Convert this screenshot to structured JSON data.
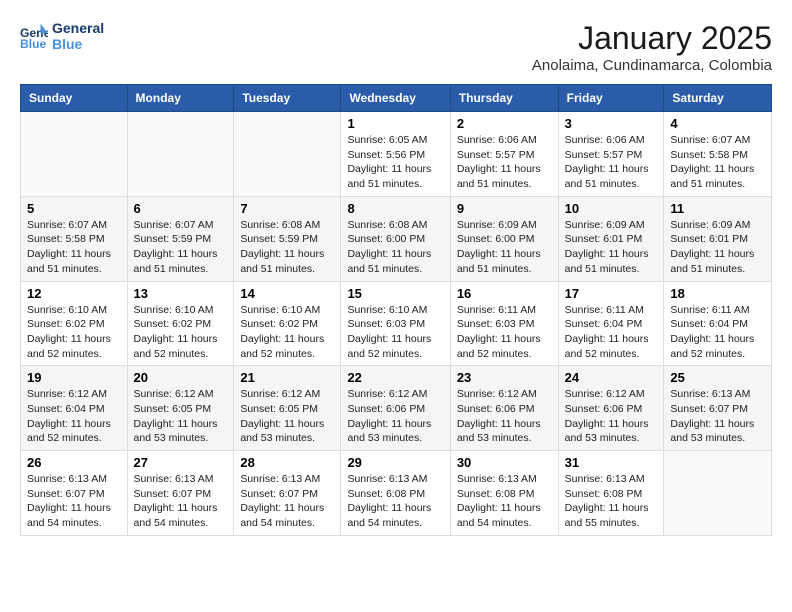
{
  "header": {
    "logo_line1": "General",
    "logo_line2": "Blue",
    "month_title": "January 2025",
    "location": "Anolaima, Cundinamarca, Colombia"
  },
  "weekdays": [
    "Sunday",
    "Monday",
    "Tuesday",
    "Wednesday",
    "Thursday",
    "Friday",
    "Saturday"
  ],
  "weeks": [
    [
      {
        "day": "",
        "sunrise": "",
        "sunset": "",
        "daylight": ""
      },
      {
        "day": "",
        "sunrise": "",
        "sunset": "",
        "daylight": ""
      },
      {
        "day": "",
        "sunrise": "",
        "sunset": "",
        "daylight": ""
      },
      {
        "day": "1",
        "sunrise": "Sunrise: 6:05 AM",
        "sunset": "Sunset: 5:56 PM",
        "daylight": "Daylight: 11 hours and 51 minutes."
      },
      {
        "day": "2",
        "sunrise": "Sunrise: 6:06 AM",
        "sunset": "Sunset: 5:57 PM",
        "daylight": "Daylight: 11 hours and 51 minutes."
      },
      {
        "day": "3",
        "sunrise": "Sunrise: 6:06 AM",
        "sunset": "Sunset: 5:57 PM",
        "daylight": "Daylight: 11 hours and 51 minutes."
      },
      {
        "day": "4",
        "sunrise": "Sunrise: 6:07 AM",
        "sunset": "Sunset: 5:58 PM",
        "daylight": "Daylight: 11 hours and 51 minutes."
      }
    ],
    [
      {
        "day": "5",
        "sunrise": "Sunrise: 6:07 AM",
        "sunset": "Sunset: 5:58 PM",
        "daylight": "Daylight: 11 hours and 51 minutes."
      },
      {
        "day": "6",
        "sunrise": "Sunrise: 6:07 AM",
        "sunset": "Sunset: 5:59 PM",
        "daylight": "Daylight: 11 hours and 51 minutes."
      },
      {
        "day": "7",
        "sunrise": "Sunrise: 6:08 AM",
        "sunset": "Sunset: 5:59 PM",
        "daylight": "Daylight: 11 hours and 51 minutes."
      },
      {
        "day": "8",
        "sunrise": "Sunrise: 6:08 AM",
        "sunset": "Sunset: 6:00 PM",
        "daylight": "Daylight: 11 hours and 51 minutes."
      },
      {
        "day": "9",
        "sunrise": "Sunrise: 6:09 AM",
        "sunset": "Sunset: 6:00 PM",
        "daylight": "Daylight: 11 hours and 51 minutes."
      },
      {
        "day": "10",
        "sunrise": "Sunrise: 6:09 AM",
        "sunset": "Sunset: 6:01 PM",
        "daylight": "Daylight: 11 hours and 51 minutes."
      },
      {
        "day": "11",
        "sunrise": "Sunrise: 6:09 AM",
        "sunset": "Sunset: 6:01 PM",
        "daylight": "Daylight: 11 hours and 51 minutes."
      }
    ],
    [
      {
        "day": "12",
        "sunrise": "Sunrise: 6:10 AM",
        "sunset": "Sunset: 6:02 PM",
        "daylight": "Daylight: 11 hours and 52 minutes."
      },
      {
        "day": "13",
        "sunrise": "Sunrise: 6:10 AM",
        "sunset": "Sunset: 6:02 PM",
        "daylight": "Daylight: 11 hours and 52 minutes."
      },
      {
        "day": "14",
        "sunrise": "Sunrise: 6:10 AM",
        "sunset": "Sunset: 6:02 PM",
        "daylight": "Daylight: 11 hours and 52 minutes."
      },
      {
        "day": "15",
        "sunrise": "Sunrise: 6:10 AM",
        "sunset": "Sunset: 6:03 PM",
        "daylight": "Daylight: 11 hours and 52 minutes."
      },
      {
        "day": "16",
        "sunrise": "Sunrise: 6:11 AM",
        "sunset": "Sunset: 6:03 PM",
        "daylight": "Daylight: 11 hours and 52 minutes."
      },
      {
        "day": "17",
        "sunrise": "Sunrise: 6:11 AM",
        "sunset": "Sunset: 6:04 PM",
        "daylight": "Daylight: 11 hours and 52 minutes."
      },
      {
        "day": "18",
        "sunrise": "Sunrise: 6:11 AM",
        "sunset": "Sunset: 6:04 PM",
        "daylight": "Daylight: 11 hours and 52 minutes."
      }
    ],
    [
      {
        "day": "19",
        "sunrise": "Sunrise: 6:12 AM",
        "sunset": "Sunset: 6:04 PM",
        "daylight": "Daylight: 11 hours and 52 minutes."
      },
      {
        "day": "20",
        "sunrise": "Sunrise: 6:12 AM",
        "sunset": "Sunset: 6:05 PM",
        "daylight": "Daylight: 11 hours and 53 minutes."
      },
      {
        "day": "21",
        "sunrise": "Sunrise: 6:12 AM",
        "sunset": "Sunset: 6:05 PM",
        "daylight": "Daylight: 11 hours and 53 minutes."
      },
      {
        "day": "22",
        "sunrise": "Sunrise: 6:12 AM",
        "sunset": "Sunset: 6:06 PM",
        "daylight": "Daylight: 11 hours and 53 minutes."
      },
      {
        "day": "23",
        "sunrise": "Sunrise: 6:12 AM",
        "sunset": "Sunset: 6:06 PM",
        "daylight": "Daylight: 11 hours and 53 minutes."
      },
      {
        "day": "24",
        "sunrise": "Sunrise: 6:12 AM",
        "sunset": "Sunset: 6:06 PM",
        "daylight": "Daylight: 11 hours and 53 minutes."
      },
      {
        "day": "25",
        "sunrise": "Sunrise: 6:13 AM",
        "sunset": "Sunset: 6:07 PM",
        "daylight": "Daylight: 11 hours and 53 minutes."
      }
    ],
    [
      {
        "day": "26",
        "sunrise": "Sunrise: 6:13 AM",
        "sunset": "Sunset: 6:07 PM",
        "daylight": "Daylight: 11 hours and 54 minutes."
      },
      {
        "day": "27",
        "sunrise": "Sunrise: 6:13 AM",
        "sunset": "Sunset: 6:07 PM",
        "daylight": "Daylight: 11 hours and 54 minutes."
      },
      {
        "day": "28",
        "sunrise": "Sunrise: 6:13 AM",
        "sunset": "Sunset: 6:07 PM",
        "daylight": "Daylight: 11 hours and 54 minutes."
      },
      {
        "day": "29",
        "sunrise": "Sunrise: 6:13 AM",
        "sunset": "Sunset: 6:08 PM",
        "daylight": "Daylight: 11 hours and 54 minutes."
      },
      {
        "day": "30",
        "sunrise": "Sunrise: 6:13 AM",
        "sunset": "Sunset: 6:08 PM",
        "daylight": "Daylight: 11 hours and 54 minutes."
      },
      {
        "day": "31",
        "sunrise": "Sunrise: 6:13 AM",
        "sunset": "Sunset: 6:08 PM",
        "daylight": "Daylight: 11 hours and 55 minutes."
      },
      {
        "day": "",
        "sunrise": "",
        "sunset": "",
        "daylight": ""
      }
    ]
  ]
}
